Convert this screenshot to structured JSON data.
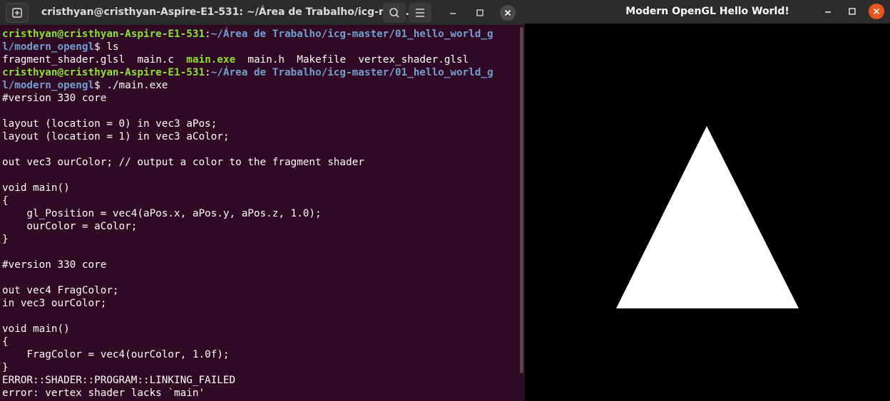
{
  "terminal": {
    "title": "cristhyan@cristhyan-Aspire-E1-531: ~/Área de Trabalho/icg-mas...",
    "icons": {
      "new_tab": "new-tab-icon",
      "search": "search-icon",
      "menu": "hamburger-icon",
      "minimize": "minimize-icon",
      "maximize": "maximize-icon",
      "close": "close-icon"
    },
    "prompt_user": "cristhyan@cristhyan-Aspire-E1-531",
    "prompt_path_line1": "~/Área de Trabalho/icg-master/01_hello_world_g",
    "prompt_path_line2": "l/modern_opengl",
    "cmd_ls": "ls",
    "ls_output": {
      "fragment_shader": "fragment_shader.glsl",
      "main_c": "main.c",
      "main_exe": "main.exe",
      "main_h": "main.h",
      "makefile": "Makefile",
      "vertex_shader": "vertex_shader.glsl"
    },
    "cmd_run": "./main.exe",
    "output": [
      "#version 330 core",
      "",
      "layout (location = 0) in vec3 aPos;",
      "layout (location = 1) in vec3 aColor;",
      "",
      "out vec3 ourColor; // output a color to the fragment shader",
      "",
      "void main()",
      "{",
      "    gl_Position = vec4(aPos.x, aPos.y, aPos.z, 1.0);",
      "    ourColor = aColor;",
      "}",
      "",
      "#version 330 core",
      "",
      "out vec4 FragColor;",
      "in vec3 ourColor;",
      "",
      "void main()",
      "{",
      "    FragColor = vec4(ourColor, 1.0f);",
      "}",
      "ERROR::SHADER::PROGRAM::LINKING_FAILED",
      "error: vertex shader lacks `main'"
    ]
  },
  "gl_window": {
    "title": "Modern OpenGL Hello World!",
    "icons": {
      "minimize": "minimize-icon",
      "maximize": "maximize-icon",
      "close": "close-icon"
    },
    "colors": {
      "background": "#000000",
      "triangle": "#ffffff",
      "close_button": "#e95420"
    }
  },
  "colors": {
    "terminal_bg": "#300a24",
    "prompt_user": "#8ae234",
    "prompt_path": "#729fcf",
    "header_bg": "#2c2c2c"
  }
}
